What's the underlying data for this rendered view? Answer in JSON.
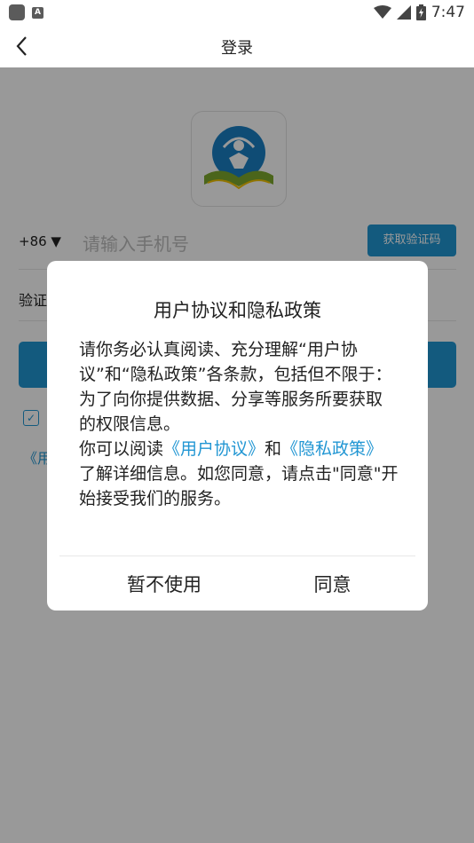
{
  "status_bar": {
    "time": "7:47",
    "notification_icon": "app-notification-icon",
    "keyboard_icon_letter": "A",
    "icons": [
      "wifi-icon",
      "signal-icon",
      "battery-charging-icon"
    ]
  },
  "header": {
    "title": "登录",
    "back_icon": "back-arrow-icon"
  },
  "login": {
    "logo_icon": "app-logo-icon",
    "country_code": "+86 ▼",
    "phone_placeholder": "请输入手机号",
    "get_code_label": "获取验证码",
    "code_label": "验证",
    "agreement_link_partial": "《用"
  },
  "dialog": {
    "title": "用户协议和隐私政策",
    "paragraph1": "请你务必认真阅读、充分理解“用户协议”和“隐私政策”各条款，包括但不限于：为了向你提供数据、分享等服务所要获取的权限信息。",
    "p2_prefix": "你可以阅读",
    "user_agreement_link": "《用户协议》",
    "p2_and": "和",
    "privacy_policy_link": "《隐私政策》",
    "p2_suffix": "了解详细信息。如您同意，请点击\"同意\"开始接受我们的服务。",
    "cancel_label": "暂不使用",
    "agree_label": "同意"
  },
  "colors": {
    "accent": "#2196d3",
    "overlay": "rgba(0,0,0,0.40)"
  }
}
